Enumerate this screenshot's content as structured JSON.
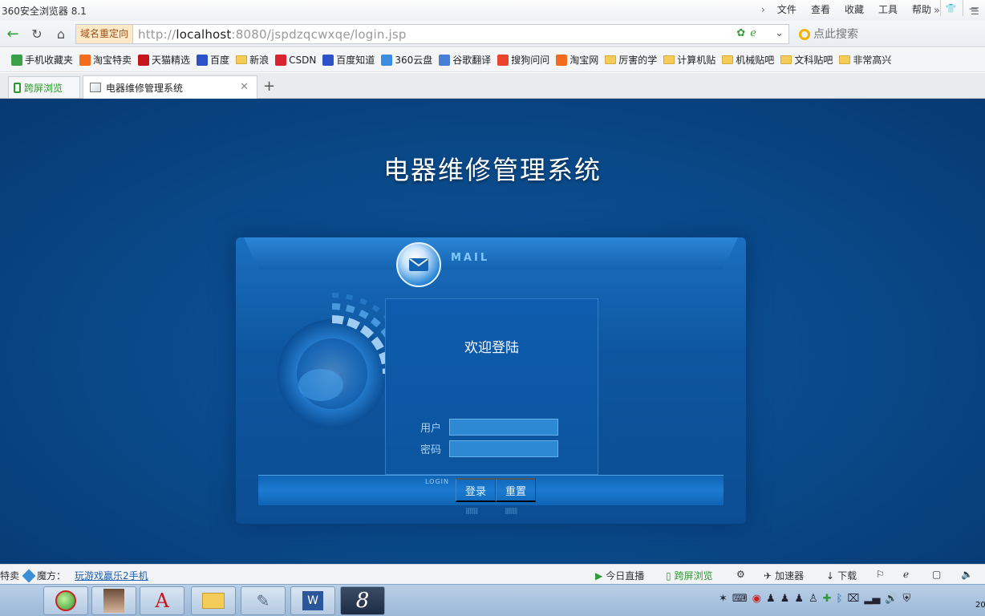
{
  "browser": {
    "title": "360安全浏览器 8.1",
    "menu": [
      "文件",
      "查看",
      "收藏",
      "工具",
      "帮助"
    ],
    "redirect_label": "域名重定向",
    "url_prefix": "http://",
    "url_host": "localhost",
    "url_rest": ":8080/jspdzqcwxqe/login.jsp",
    "search_placeholder": "点此搜索"
  },
  "bookmarks": [
    {
      "label": "手机收藏夹",
      "icon": "phone-icon",
      "color": "#3aa04a"
    },
    {
      "label": "淘宝特卖",
      "icon": "taobao-icon",
      "color": "#f36b1c"
    },
    {
      "label": "天猫精选",
      "icon": "tmall-icon",
      "color": "#c4161c"
    },
    {
      "label": "百度",
      "icon": "baidu-icon",
      "color": "#2b52c7"
    },
    {
      "label": "新浪",
      "icon": "folder-icon",
      "color": "#f4cc5a"
    },
    {
      "label": "CSDN",
      "icon": "csdn-icon",
      "color": "#d9232e"
    },
    {
      "label": "百度知道",
      "icon": "baidu-icon",
      "color": "#2b52c7"
    },
    {
      "label": "360云盘",
      "icon": "cloud-icon",
      "color": "#3a8de0"
    },
    {
      "label": "谷歌翻译",
      "icon": "translate-icon",
      "color": "#4a7fd6"
    },
    {
      "label": "搜狗问问",
      "icon": "sogou-icon",
      "color": "#e8452c"
    },
    {
      "label": "淘宝网",
      "icon": "taobao-icon",
      "color": "#f36b1c"
    },
    {
      "label": "厉害的学",
      "icon": "folder-icon",
      "color": "#f4cc5a"
    },
    {
      "label": "计算机贴",
      "icon": "folder-icon",
      "color": "#f4cc5a"
    },
    {
      "label": "机械贴吧",
      "icon": "folder-icon",
      "color": "#f4cc5a"
    },
    {
      "label": "文科贴吧",
      "icon": "folder-icon",
      "color": "#f4cc5a"
    },
    {
      "label": "非常高兴",
      "icon": "folder-icon",
      "color": "#f4cc5a"
    }
  ],
  "tabs": {
    "cross_screen": "跨屏浏览",
    "active": "电器维修管理系统"
  },
  "page": {
    "system_title": "电器维修管理系统",
    "mail_badge": "MAIL",
    "welcome": "欢迎登陆",
    "user_label": "用户",
    "password_label": "密码",
    "login_tag": "LOGIN",
    "login_button": "登录",
    "reset_button": "重置"
  },
  "statusbar": {
    "left_fragment": "特卖",
    "magic_label": "魔方：",
    "magic_link": "玩游戏赢乐2手机",
    "live": "今日直播",
    "cross_screen": "跨屏浏览",
    "accelerator": "加速器",
    "download": "下载"
  },
  "taskbar": {
    "clock_fragment": "20"
  }
}
